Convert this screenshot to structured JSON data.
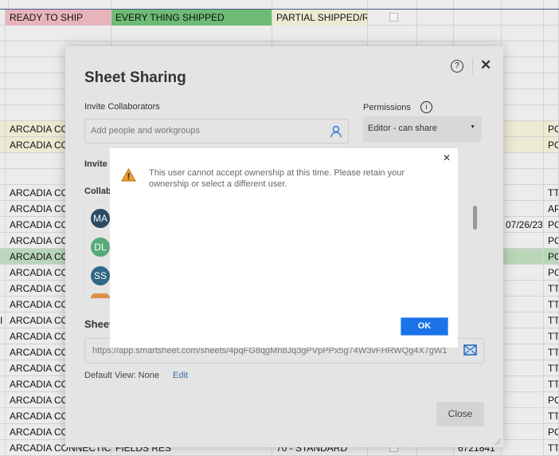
{
  "sheet": {
    "rows": [
      {
        "c1": "READY TO SHIP",
        "c2": "EVERY THING SHIPPED",
        "c3": "PARTIAL SHIPPED/RE",
        "cb": true,
        "bg1": "#e8b4bc",
        "bg2": "#6dbb74",
        "bg3": "#ecead2"
      },
      {},
      {},
      {},
      {},
      {},
      {},
      {
        "c1": "ARCADIA CO",
        "c8": "PO",
        "bg": "#ecead2"
      },
      {
        "c1": "ARCADIA CO",
        "c8": "PO",
        "bg": "#ecead2"
      },
      {},
      {},
      {
        "c1": "ARCADIA CO",
        "c8": "TT-"
      },
      {
        "c1": "ARCADIA CO",
        "c8": "AP"
      },
      {
        "c1": "ARCADIA CO",
        "c7": "07/26/23",
        "c8": "PO"
      },
      {
        "c1": "ARCADIA CO",
        "c8": "PO"
      },
      {
        "c1": "ARCADIA CO",
        "c8": "PO",
        "bg": "#b9d6b9"
      },
      {
        "c1": "ARCADIA CO",
        "c8": "PO"
      },
      {
        "c1": "ARCADIA CO",
        "c8": "TT-"
      },
      {
        "c1": "ARCADIA CO",
        "c8": "TT-"
      },
      {
        "c0": "I",
        "c1": "ARCADIA CO",
        "c8": "TT-"
      },
      {
        "c1": "ARCADIA CO",
        "c8": "TT-"
      },
      {
        "c1": "ARCADIA CO",
        "c8": "TT-"
      },
      {
        "c1": "ARCADIA CO",
        "c8": "TT-"
      },
      {
        "c1": "ARCADIA CO",
        "c8": "TT"
      },
      {
        "c1": "ARCADIA CO",
        "c8": "PO"
      },
      {
        "c1": "ARCADIA CO",
        "c8": "TT-"
      },
      {
        "c1": "ARCADIA CO",
        "c8": "PO"
      },
      {
        "c1": "ARCADIA CONNECTICU",
        "c2": "FIELDS RES",
        "c3": "70 - STANDARD",
        "cb": true,
        "c6": "6721841",
        "c8": "TT-"
      }
    ]
  },
  "dialog": {
    "title": "Sheet Sharing",
    "invite_label": "Invite Collaborators",
    "invite_placeholder": "Add people and workgroups",
    "permissions_label": "Permissions",
    "permission_value": "Editor - can share",
    "invite_msg_label": "Invite M",
    "collaborators_label": "Collab",
    "collaborators": [
      {
        "initials": "MA",
        "color": "#2b4a63"
      },
      {
        "initials": "DL",
        "color": "#55aa77"
      },
      {
        "initials": "SS",
        "color": "#2f6785"
      },
      {
        "initials": "",
        "color": "#d9914a"
      }
    ],
    "sheet_link_label": "Sheet",
    "sheet_url": "https://app.smartsheet.com/sheets/4pqFG8qgMh8Jq3gPVpPPx5g74W3vFHRWQg4X7gW1",
    "default_view": "Default View: None",
    "edit_link": "Edit",
    "close_label": "Close"
  },
  "alert": {
    "message": "This user cannot accept ownership at this time. Please retain your ownership or select a different user.",
    "ok_label": "OK",
    "icon": "warning-icon",
    "accent": "#1a73e8"
  }
}
